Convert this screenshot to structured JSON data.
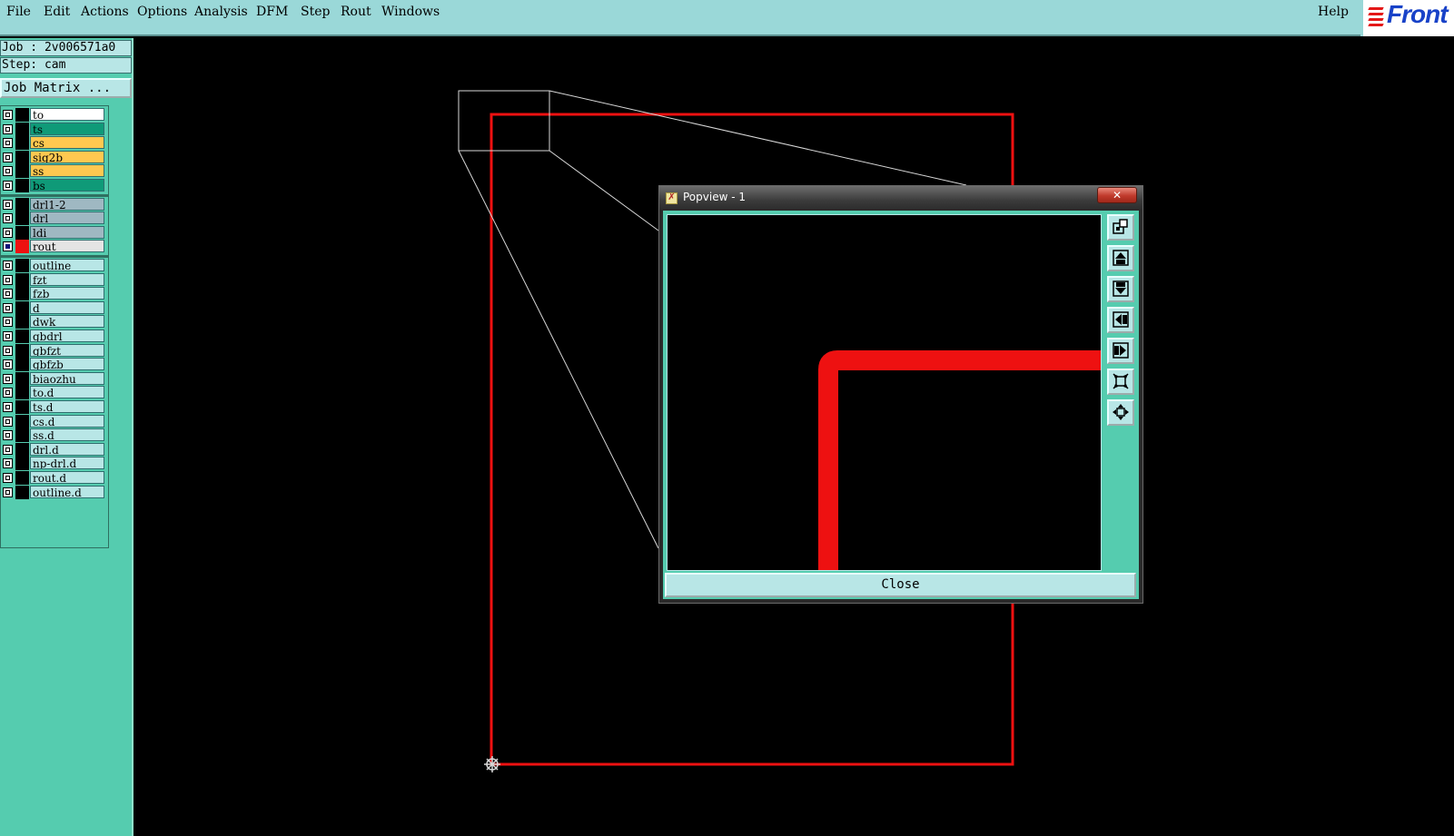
{
  "menubar": {
    "items": [
      {
        "label": "File"
      },
      {
        "label": "Edit"
      },
      {
        "label": "Actions"
      },
      {
        "label": "Options"
      },
      {
        "label": "Analysis"
      },
      {
        "label": "DFM"
      },
      {
        "label": "Step"
      },
      {
        "label": "Rout"
      },
      {
        "label": "Windows"
      }
    ],
    "help": "Help",
    "logo_text": "Front"
  },
  "left_panel": {
    "job": "Job : 2v006571a0",
    "step": "Step: cam",
    "job_matrix_button": "Job Matrix ...",
    "layers": [
      {
        "name": "to",
        "bg": "#ffffff",
        "checked": false,
        "color": "#000000"
      },
      {
        "name": "ts",
        "bg": "#0f9a78",
        "checked": false,
        "color": "#000000"
      },
      {
        "name": "cs",
        "bg": "#ffc850",
        "checked": false,
        "color": "#000000"
      },
      {
        "name": "sig2b",
        "bg": "#ffc850",
        "checked": false,
        "color": "#000000"
      },
      {
        "name": "ss",
        "bg": "#ffc850",
        "checked": false,
        "color": "#000000"
      },
      {
        "name": "bs",
        "bg": "#0f9a78",
        "checked": false,
        "color": "#000000"
      },
      {
        "name": "drl1-2",
        "bg": "#9fb8c2",
        "checked": false,
        "color": "#000000"
      },
      {
        "name": "drl",
        "bg": "#9fb8c2",
        "checked": false,
        "color": "#000000"
      },
      {
        "name": "ldi",
        "bg": "#9fb8c2",
        "checked": false,
        "color": "#000000"
      },
      {
        "name": "rout",
        "bg": "#e4e4e4",
        "checked": true,
        "color": "#ee1111"
      },
      {
        "name": "outline",
        "bg": "#b8e6e6",
        "checked": false,
        "color": "#000000"
      },
      {
        "name": "fzt",
        "bg": "#b8e6e6",
        "checked": false,
        "color": "#000000"
      },
      {
        "name": "fzb",
        "bg": "#b8e6e6",
        "checked": false,
        "color": "#000000"
      },
      {
        "name": "d",
        "bg": "#b8e6e6",
        "checked": false,
        "color": "#000000"
      },
      {
        "name": "dwk",
        "bg": "#b8e6e6",
        "checked": false,
        "color": "#000000"
      },
      {
        "name": "gbdrl",
        "bg": "#b8e6e6",
        "checked": false,
        "color": "#000000"
      },
      {
        "name": "gbfzt",
        "bg": "#b8e6e6",
        "checked": false,
        "color": "#000000"
      },
      {
        "name": "gbfzb",
        "bg": "#b8e6e6",
        "checked": false,
        "color": "#000000"
      },
      {
        "name": "biaozhu",
        "bg": "#b8e6e6",
        "checked": false,
        "color": "#000000"
      },
      {
        "name": "to.d",
        "bg": "#b8e6e6",
        "checked": false,
        "color": "#000000"
      },
      {
        "name": "ts.d",
        "bg": "#b8e6e6",
        "checked": false,
        "color": "#000000"
      },
      {
        "name": "cs.d",
        "bg": "#b8e6e6",
        "checked": false,
        "color": "#000000"
      },
      {
        "name": "ss.d",
        "bg": "#b8e6e6",
        "checked": false,
        "color": "#000000"
      },
      {
        "name": "drl.d",
        "bg": "#b8e6e6",
        "checked": false,
        "color": "#000000"
      },
      {
        "name": "np-drl.d",
        "bg": "#b8e6e6",
        "checked": false,
        "color": "#000000"
      },
      {
        "name": "rout.d",
        "bg": "#b8e6e6",
        "checked": false,
        "color": "#000000"
      },
      {
        "name": "outline.d",
        "bg": "#b8e6e6",
        "checked": false,
        "color": "#000000"
      }
    ]
  },
  "popview": {
    "title": "Popview - 1",
    "close_x": "✕",
    "close_button": "Close",
    "tools": [
      "zoom-window-icon",
      "pan-up-icon",
      "pan-down-icon",
      "pan-left-icon",
      "pan-right-icon",
      "zoom-out-icon",
      "zoom-home-icon"
    ]
  },
  "colors": {
    "rout_line": "#ee1111",
    "menu_bg": "#9ad8d8",
    "panel_bg": "#55ccaf"
  }
}
